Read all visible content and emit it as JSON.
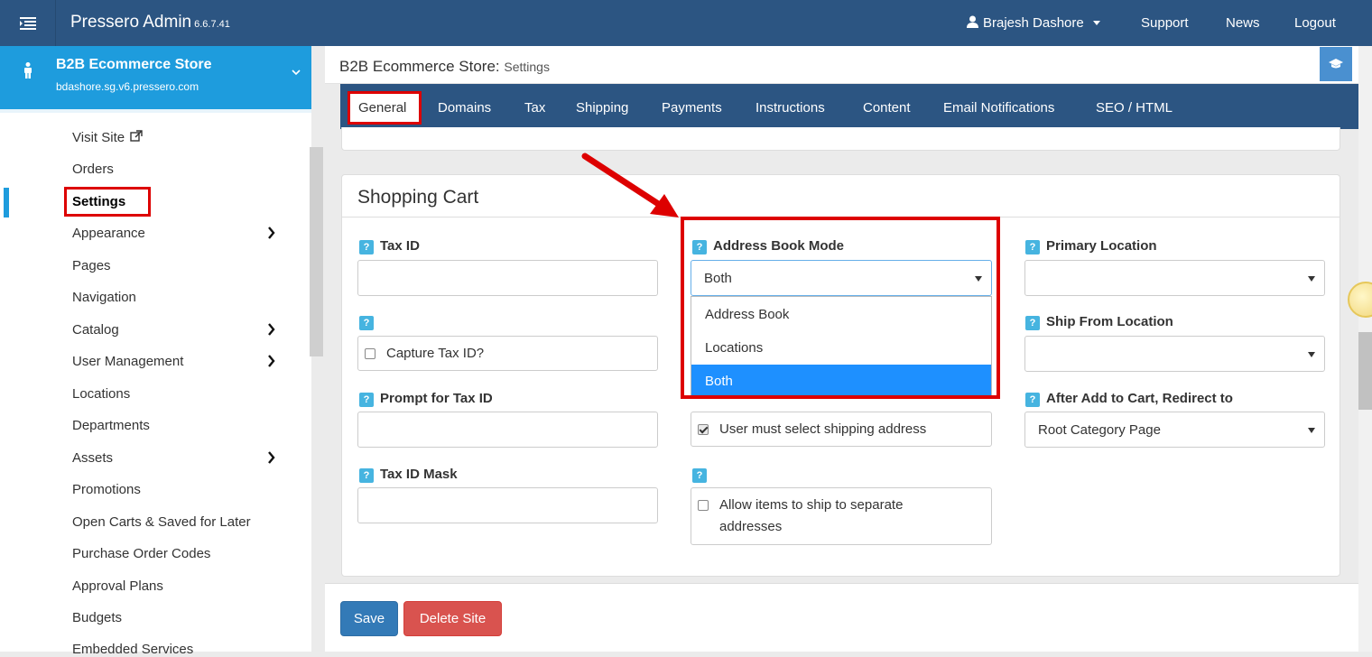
{
  "topbar": {
    "app_name": "Pressero Admin",
    "version": "6.6.7.41",
    "user": "Brajesh Dashore",
    "support": "Support",
    "news": "News",
    "logout": "Logout"
  },
  "site": {
    "name": "B2B Ecommerce Store",
    "url": "bdashore.sg.v6.pressero.com"
  },
  "sidebar": {
    "items": [
      {
        "label": "Visit Site"
      },
      {
        "label": "Orders"
      },
      {
        "label": "Settings"
      },
      {
        "label": "Appearance"
      },
      {
        "label": "Pages"
      },
      {
        "label": "Navigation"
      },
      {
        "label": "Catalog"
      },
      {
        "label": "User Management"
      },
      {
        "label": "Locations"
      },
      {
        "label": "Departments"
      },
      {
        "label": "Assets"
      },
      {
        "label": "Promotions"
      },
      {
        "label": "Open Carts & Saved for Later"
      },
      {
        "label": "Purchase Order Codes"
      },
      {
        "label": "Approval Plans"
      },
      {
        "label": "Budgets"
      },
      {
        "label": "Embedded Services"
      }
    ]
  },
  "header": {
    "title": "B2B Ecommerce Store:",
    "subtitle": "Settings"
  },
  "tabs": [
    "General",
    "Domains",
    "Tax",
    "Shipping",
    "Payments",
    "Instructions",
    "Content",
    "Email Notifications",
    "SEO / HTML"
  ],
  "cart": {
    "title": "Shopping Cart",
    "badge": "?",
    "tax_id_label": "Tax ID",
    "capture_tax_id": "Capture Tax ID?",
    "prompt_label": "Prompt for Tax ID",
    "mask_label": "Tax ID Mask",
    "address_book_mode_label": "Address Book Mode",
    "address_book_mode_value": "Both",
    "address_options": [
      "Address Book",
      "Locations",
      "Both"
    ],
    "must_select_shipping": "User must select shipping address",
    "ship_separate_line1": "Allow items to ship to separate",
    "ship_separate_line2": "addresses",
    "primary_location_label": "Primary Location",
    "ship_from_label": "Ship From Location",
    "redirect_label": "After Add to Cart, Redirect to",
    "redirect_value": "Root Category Page"
  },
  "buttons": {
    "save": "Save",
    "delete": "Delete Site"
  },
  "colors": {
    "topbar": "#2c5582",
    "accent": "#1e9cdd",
    "highlight": "#dd0000",
    "selected_option": "#1e90ff"
  }
}
